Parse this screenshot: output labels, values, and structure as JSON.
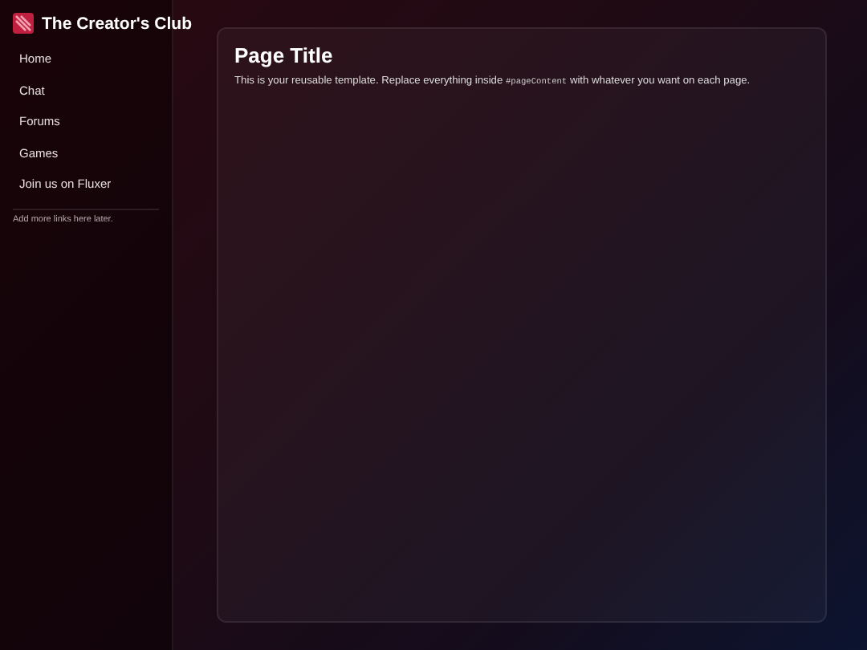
{
  "sidebar": {
    "brand": "The Creator's Club",
    "items": [
      {
        "label": "Home"
      },
      {
        "label": "Chat"
      },
      {
        "label": "Forums"
      },
      {
        "label": "Games"
      },
      {
        "label": "Join us on Fluxer"
      }
    ],
    "note": "Add more links here later."
  },
  "page": {
    "title": "Page Title",
    "intro": {
      "before": "This is your reusable template. Replace everything inside ",
      "code": "#pageContent",
      "after": " with whatever you want on each page."
    }
  }
}
